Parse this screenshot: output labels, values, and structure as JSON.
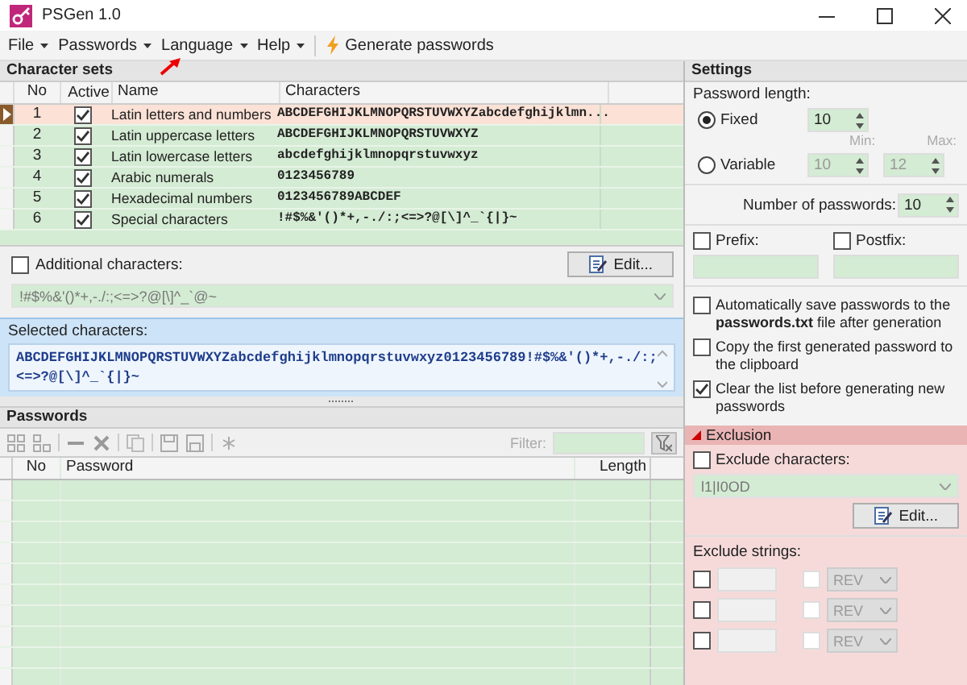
{
  "window": {
    "title": "PSGen 1.0"
  },
  "menu": [
    {
      "label": "File",
      "dropdown": true
    },
    {
      "label": "Passwords",
      "dropdown": true
    },
    {
      "label": "Language",
      "dropdown": true
    },
    {
      "label": "Help",
      "dropdown": true
    }
  ],
  "toolbar": {
    "generate_button": "Generate passwords"
  },
  "character_sets": {
    "title": "Character sets",
    "columns": [
      "No",
      "Active",
      "Name",
      "Characters"
    ],
    "rows": [
      {
        "no": "1",
        "active": true,
        "selected": true,
        "name": "Latin letters and numbers",
        "characters": "ABCDEFGHIJKLMNOPQRSTUVWXYZabcdefghijklmn..."
      },
      {
        "no": "2",
        "active": true,
        "selected": false,
        "name": "Latin uppercase letters",
        "characters": "ABCDEFGHIJKLMNOPQRSTUVWXYZ"
      },
      {
        "no": "3",
        "active": true,
        "selected": false,
        "name": "Latin lowercase letters",
        "characters": "abcdefghijklmnopqrstuvwxyz"
      },
      {
        "no": "4",
        "active": true,
        "selected": false,
        "name": "Arabic numerals",
        "characters": "0123456789"
      },
      {
        "no": "5",
        "active": true,
        "selected": false,
        "name": "Hexadecimal numbers",
        "characters": "0123456789ABCDEF"
      },
      {
        "no": "6",
        "active": true,
        "selected": false,
        "name": "Special characters",
        "characters": "!#$%&'()*+,-./:;<=>?@[\\]^_`{|}~"
      }
    ]
  },
  "additional": {
    "label": "Additional characters:",
    "checked": false,
    "value": "!#$%&'()*+,-./:;<=>?@[\\]^_`@~",
    "edit_button": "Edit..."
  },
  "selected_characters": {
    "label": "Selected characters:",
    "value": "ABCDEFGHIJKLMNOPQRSTUVWXYZabcdefghijklmnopqrstuvwxyz0123456789!#$%&'()*+,-./:;<=>?@[\\]^_`{|}~"
  },
  "passwords": {
    "title": "Passwords",
    "filter_label": "Filter:",
    "columns": [
      "No",
      "Password",
      "Length"
    ]
  },
  "settings": {
    "title": "Settings",
    "length_label": "Password length:",
    "fixed": {
      "label": "Fixed",
      "selected": true,
      "value": "10"
    },
    "variable": {
      "label": "Variable",
      "selected": false,
      "min_label": "Min:",
      "min_value": "10",
      "max_label": "Max:",
      "max_value": "12"
    },
    "count_label": "Number of passwords:",
    "count_value": "10",
    "prefix": {
      "label": "Prefix:",
      "checked": false
    },
    "postfix": {
      "label": "Postfix:",
      "checked": false
    },
    "options": [
      {
        "text": "Automatically save passwords to the **passwords.txt** file after generation",
        "checked": false
      },
      {
        "text": "Copy the first generated password to the clipboard",
        "checked": false
      },
      {
        "text": "Clear the list before generating new passwords",
        "checked": true
      }
    ]
  },
  "exclusion": {
    "title": "Exclusion",
    "expanded": true,
    "exclude_chars": {
      "label": "Exclude characters:",
      "checked": false,
      "value": "l1|I0OD"
    },
    "edit_button": "Edit...",
    "strings_label": "Exclude strings:",
    "strings": [
      {
        "checked": false,
        "rev_checked": false,
        "mode": "REV"
      },
      {
        "checked": false,
        "rev_checked": false,
        "mode": "REV"
      },
      {
        "checked": false,
        "rev_checked": false,
        "mode": "REV"
      }
    ]
  }
}
